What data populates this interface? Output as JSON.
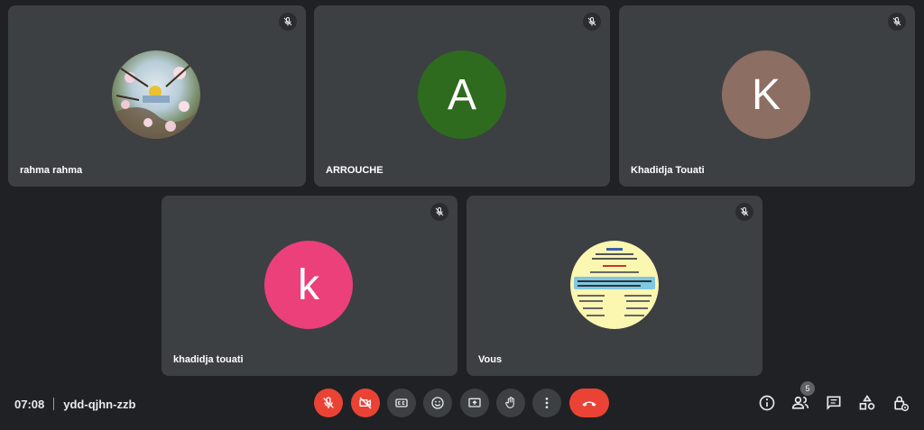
{
  "participants": [
    {
      "name": "rahma rahma",
      "avatar_type": "photo",
      "muted": true
    },
    {
      "name": "ARROUCHE",
      "initial": "A",
      "avatar_color": "#2e6b1e",
      "muted": true
    },
    {
      "name": "Khadidja Touati",
      "initial": "K",
      "avatar_color": "#8d6e63",
      "muted": true
    },
    {
      "name": "khadidja touati",
      "initial": "k",
      "avatar_color": "#ec407a",
      "muted": true
    },
    {
      "name": "Vous",
      "avatar_type": "document-image",
      "muted": true
    }
  ],
  "meeting": {
    "time": "07:08",
    "code": "ydd-qjhn-zzb"
  },
  "controls": {
    "icons": [
      "mic-off-icon",
      "camera-off-icon",
      "captions-icon",
      "emoji-icon",
      "present-icon",
      "raise-hand-icon",
      "more-options-icon",
      "end-call-icon"
    ]
  },
  "right_panel": {
    "icons": [
      "info-icon",
      "people-icon",
      "chat-icon",
      "activities-icon",
      "host-controls-icon"
    ],
    "people_count": "5"
  },
  "colors": {
    "background": "#202124",
    "tile": "#3c4043",
    "danger": "#ea4335"
  }
}
